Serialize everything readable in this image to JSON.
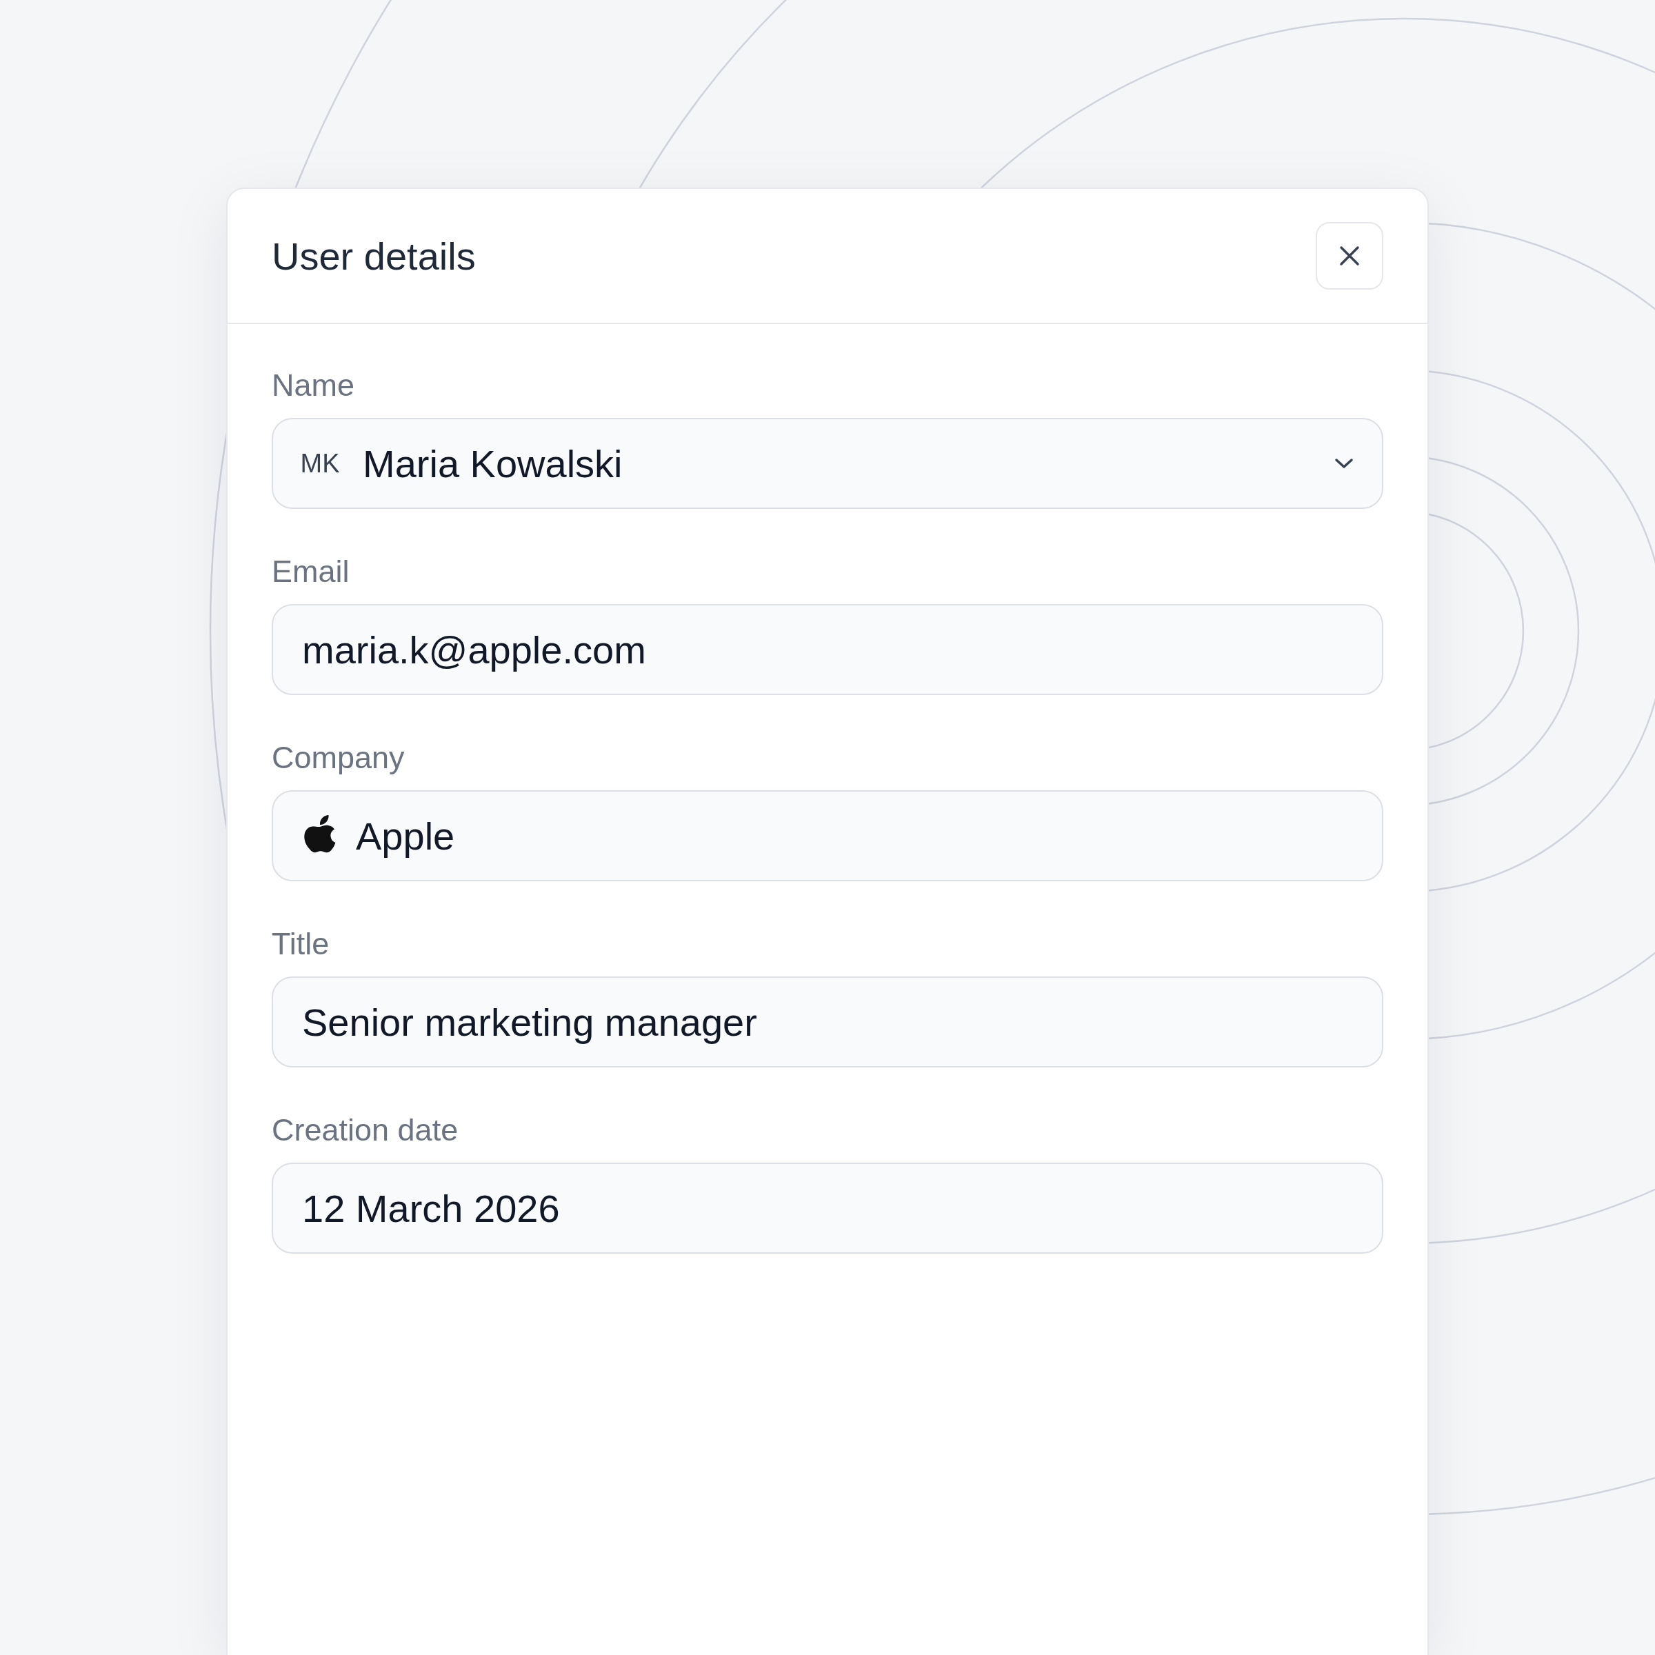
{
  "dialog": {
    "title": "User details",
    "fields": [
      {
        "kind": "select",
        "label": "Name",
        "avatar": "MK",
        "value": "Maria Kowalski"
      },
      {
        "kind": "text",
        "label": "Email",
        "value": "maria.k@apple.com"
      },
      {
        "kind": "company",
        "label": "Company",
        "value": "Apple"
      },
      {
        "kind": "text",
        "label": "Title",
        "value": "Senior marketing manager"
      },
      {
        "kind": "text",
        "label": "Creation date",
        "value": "12 March 2026"
      }
    ]
  }
}
